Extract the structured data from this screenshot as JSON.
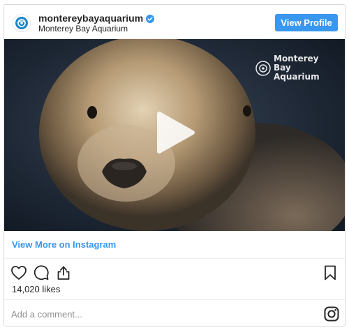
{
  "header": {
    "username": "montereybayaquarium",
    "full_name": "Monterey Bay Aquarium",
    "verified": true,
    "view_profile_label": "View Profile",
    "avatar_icon": "aquarium-logo-icon"
  },
  "media": {
    "watermark": "Monterey Bay Aquarium",
    "play_icon": "play-icon"
  },
  "links": {
    "view_more_label": "View More on Instagram"
  },
  "actions": {
    "like_icon": "heart-icon",
    "comment_icon": "comment-icon",
    "share_icon": "share-icon",
    "save_icon": "bookmark-icon"
  },
  "likes_text": "14,020 likes",
  "comment": {
    "placeholder": "Add a comment...",
    "instagram_icon": "instagram-icon"
  },
  "colors": {
    "accent": "#3897f0",
    "text": "#262626",
    "muted": "#8e8e8e",
    "border": "#dbdbdb"
  }
}
